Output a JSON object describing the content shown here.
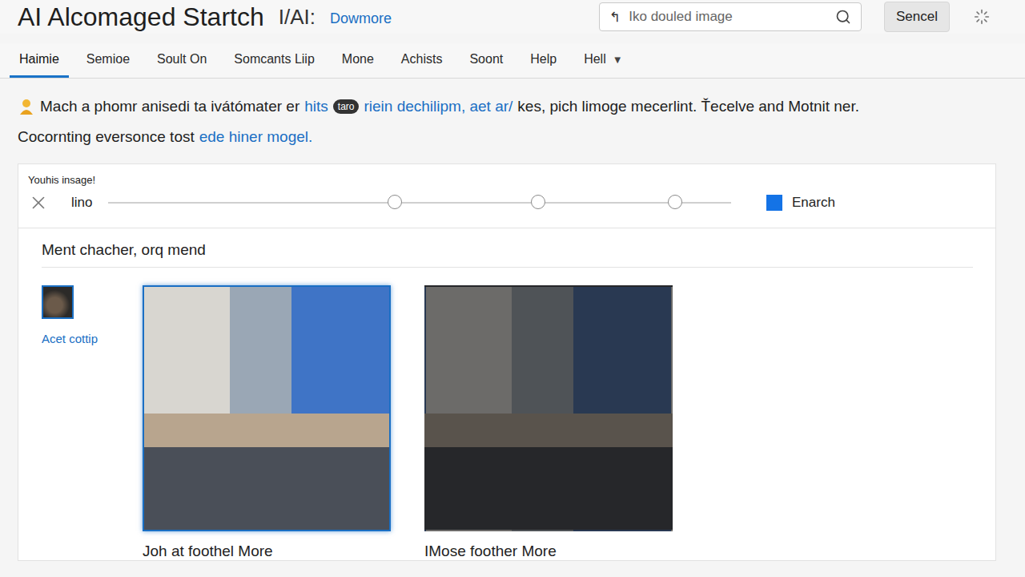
{
  "header": {
    "title": "AI Alcomaged Startch",
    "glyph": "I/AI:",
    "link": "Dowmore"
  },
  "search": {
    "icon": "↰",
    "placeholder": "Iko douled image"
  },
  "buttons": [
    "Sencel"
  ],
  "tabs": [
    {
      "label": "Haimie",
      "selected": true
    },
    {
      "label": "Semioe",
      "selected": false
    },
    {
      "label": "Soult On",
      "selected": false
    },
    {
      "label": "Somcants Liip",
      "selected": false
    },
    {
      "label": "Mone",
      "selected": false
    },
    {
      "label": "Achists",
      "selected": false
    },
    {
      "label": "Soont",
      "selected": false
    },
    {
      "label": "Help",
      "selected": false
    },
    {
      "label": "Hell",
      "selected": false,
      "caret": "▼"
    }
  ],
  "notice": {
    "lines": [
      [
        {
          "text": "Mach a phomr anisedi ta ivátómater er",
          "kind": "plain"
        },
        {
          "text": "hits",
          "kind": "link"
        },
        {
          "text": "taro",
          "kind": "badge"
        },
        {
          "text": "riein dechilipm, aet ar/",
          "kind": "link"
        },
        {
          "text": "kes, pich limoge mecerlint. Ťecelve and Motnit ner.",
          "kind": "plain"
        }
      ],
      [
        {
          "text": "Cocornting eversonce tost",
          "kind": "plain"
        },
        {
          "text": "ede hiner mogel.",
          "kind": "link"
        }
      ]
    ]
  },
  "filter": {
    "label": "Youhis insage!",
    "field": "lino",
    "handles": [
      {
        "level": 0.46
      },
      {
        "level": 0.69
      },
      {
        "level": 0.91
      }
    ],
    "checkbox": {
      "label": "Enarch",
      "checked": true
    }
  },
  "results": {
    "heading": "Ment chacher, orq mend",
    "thumbnail": {
      "label": "Acet cottip",
      "selected": true
    },
    "images": [
      {
        "caption": "Joh at foothel More",
        "selected": true
      },
      {
        "caption": "IMose foother More",
        "selected": false
      }
    ]
  }
}
